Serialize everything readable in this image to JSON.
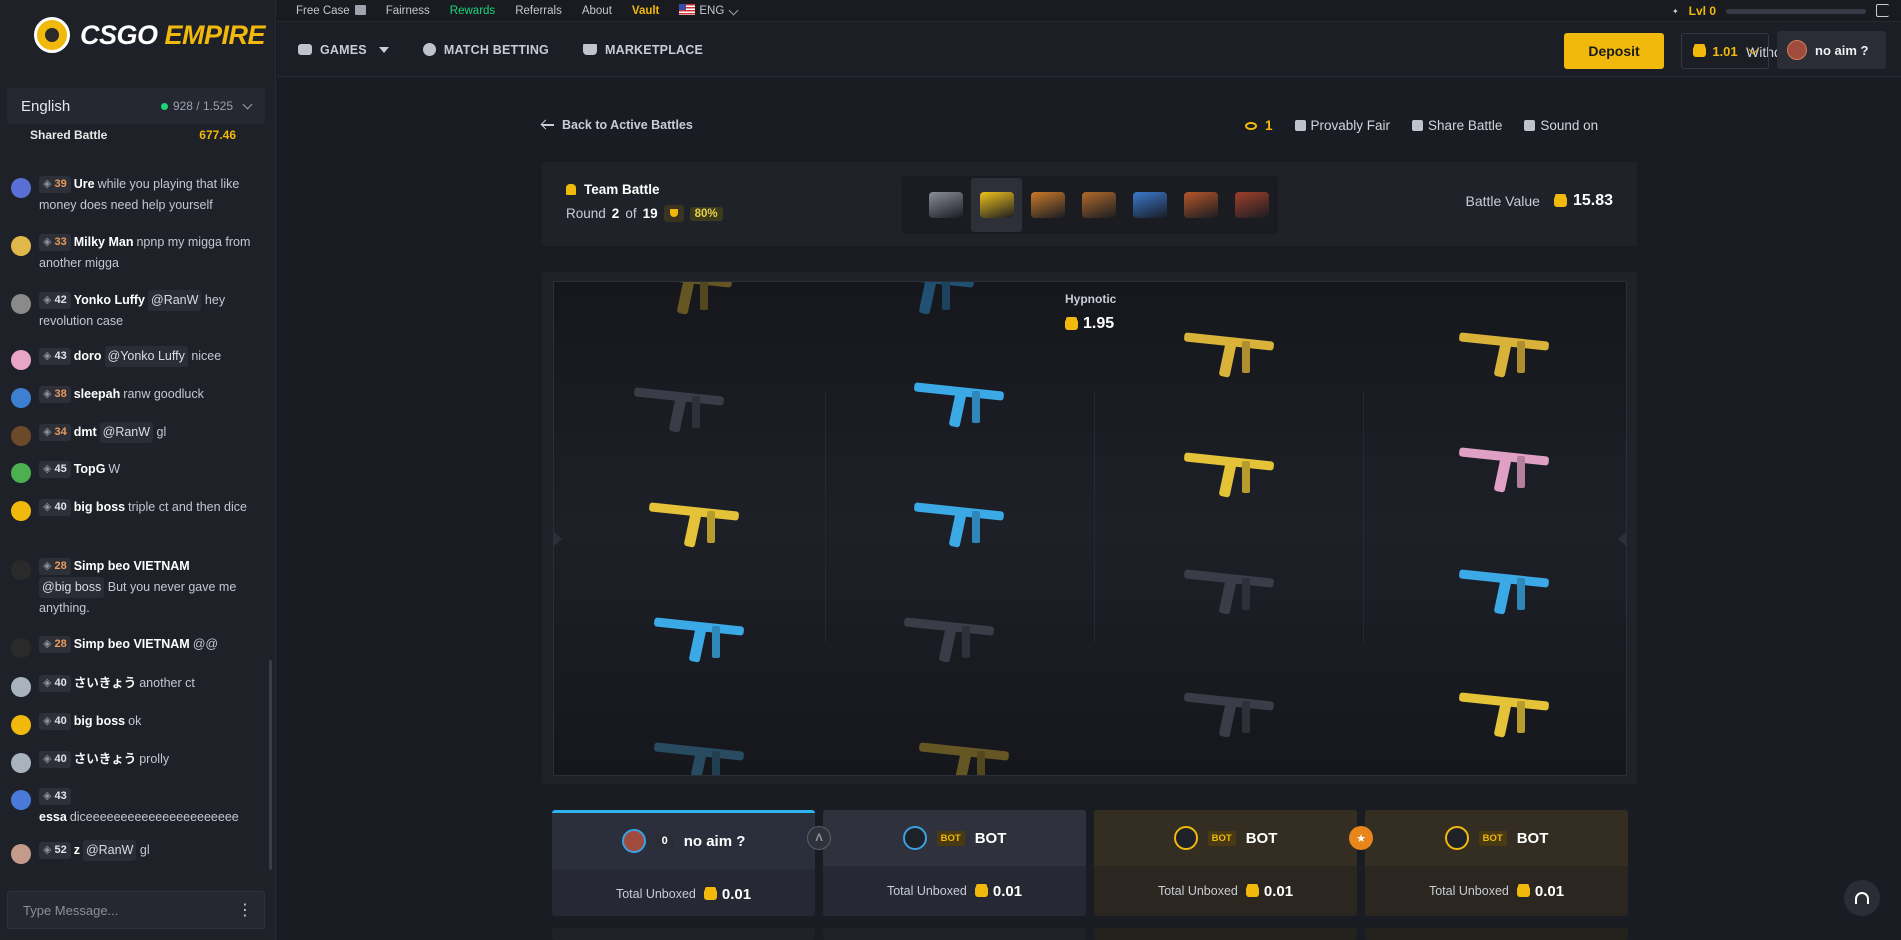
{
  "brand": {
    "logo_text_a": "CSGO",
    "logo_text_b": "EMPIRE"
  },
  "topbar": {
    "links": [
      "Free Case",
      "Fairness",
      "Rewards",
      "Referrals",
      "About",
      "Vault"
    ],
    "language": "ENG",
    "level": "Lvl 0"
  },
  "nav": {
    "games": "GAMES",
    "match_betting": "MATCH BETTING",
    "marketplace": "MARKETPLACE",
    "withdraw": "Withdraw",
    "deposit": "Deposit",
    "balance": "1.01",
    "username": "no aim ?"
  },
  "sidebar": {
    "language": "English",
    "online": "928 / 1.525",
    "shared_label": "Shared Battle",
    "shared_value": "677.46",
    "input_placeholder": "Type Message...",
    "messages": [
      {
        "level": "39",
        "user": "Ure",
        "text": "while you playing that like money does need help yourself",
        "mention": "",
        "lvl_color": "orange",
        "avatar": "#5a6fd6"
      },
      {
        "level": "33",
        "user": "Milky Man",
        "text": "npnp my migga from another migga",
        "mention": "",
        "lvl_color": "orange",
        "avatar": "#e0b84a"
      },
      {
        "level": "42",
        "user": "Yonko Luffy",
        "text": "hey revolution case",
        "mention": "@RanW",
        "lvl_color": "white",
        "avatar": "#8a8a8a"
      },
      {
        "level": "43",
        "user": "doro",
        "text": "nicee",
        "mention": "@Yonko Luffy",
        "lvl_color": "white",
        "avatar": "#e8a5c5"
      },
      {
        "level": "38",
        "user": "sleepah",
        "text": "ranw goodluck",
        "mention": "",
        "lvl_color": "orange",
        "avatar": "#3d7fd1"
      },
      {
        "level": "34",
        "user": "dmt",
        "text": "gl",
        "mention": "@RanW",
        "lvl_color": "orange",
        "avatar": "#6b4a2a"
      },
      {
        "level": "45",
        "user": "TopG",
        "text": "W",
        "mention": "",
        "lvl_color": "white",
        "avatar": "#4caf50"
      },
      {
        "level": "40",
        "user": "big boss",
        "text": "triple ct and then dice",
        "mention": "",
        "lvl_color": "white",
        "avatar": "#f0b90b"
      },
      {
        "level": "28",
        "user": "Simp beo VIETNAM",
        "text": "But you never gave me anything.",
        "mention": "@big boss",
        "lvl_color": "orange",
        "avatar": "#2a2a2a"
      },
      {
        "level": "28",
        "user": "Simp beo VIETNAM",
        "text": "@@",
        "mention": "",
        "lvl_color": "orange",
        "avatar": "#2a2a2a"
      },
      {
        "level": "40",
        "user": "さいきょう",
        "text": "another ct",
        "mention": "",
        "lvl_color": "white",
        "avatar": "#a9b3bd"
      },
      {
        "level": "40",
        "user": "big boss",
        "text": "ok",
        "mention": "",
        "lvl_color": "white",
        "avatar": "#f0b90b"
      },
      {
        "level": "40",
        "user": "さいきょう",
        "text": "prolly",
        "mention": "",
        "lvl_color": "white",
        "avatar": "#a9b3bd"
      },
      {
        "level": "43",
        "user": "essa",
        "text": "diceeeeeeeeeeeeeeeeeeeeee",
        "mention": "",
        "lvl_color": "white",
        "avatar": "#4a7ad9"
      },
      {
        "level": "52",
        "user": "z",
        "text": "gl",
        "mention": "@RanW",
        "lvl_color": "white",
        "avatar": "#c49a8a"
      }
    ]
  },
  "battle": {
    "back_label": "Back to Active Battles",
    "viewers": "1",
    "provably_fair": "Provably Fair",
    "share": "Share Battle",
    "sound": "Sound on",
    "title": "Team Battle",
    "round_prefix": "Round",
    "round_current": "2",
    "round_of": "of",
    "round_total": "19",
    "bonus_pct": "80%",
    "battle_value_label": "Battle Value",
    "battle_value": "15.83",
    "case_colors": [
      "#8a8e99",
      "#f0c21a",
      "#c97a2a",
      "#b06a2a",
      "#3a7acf",
      "#b5562a",
      "#a0402a"
    ],
    "current_item_name": "Hypnotic",
    "current_item_value": "1.95"
  },
  "players": [
    {
      "name": "no aim ?",
      "badge": "0",
      "type": "user",
      "total_label": "Total Unboxed",
      "total": "0.01"
    },
    {
      "name": "BOT",
      "badge": "BOT",
      "type": "bot-blue",
      "total_label": "Total Unboxed",
      "total": "0.01"
    },
    {
      "name": "BOT",
      "badge": "BOT",
      "type": "bot-gold",
      "total_label": "Total Unboxed",
      "total": "0.01"
    },
    {
      "name": "BOT",
      "badge": "BOT",
      "type": "bot-gold",
      "total_label": "Total Unboxed",
      "total": "0.01"
    }
  ]
}
